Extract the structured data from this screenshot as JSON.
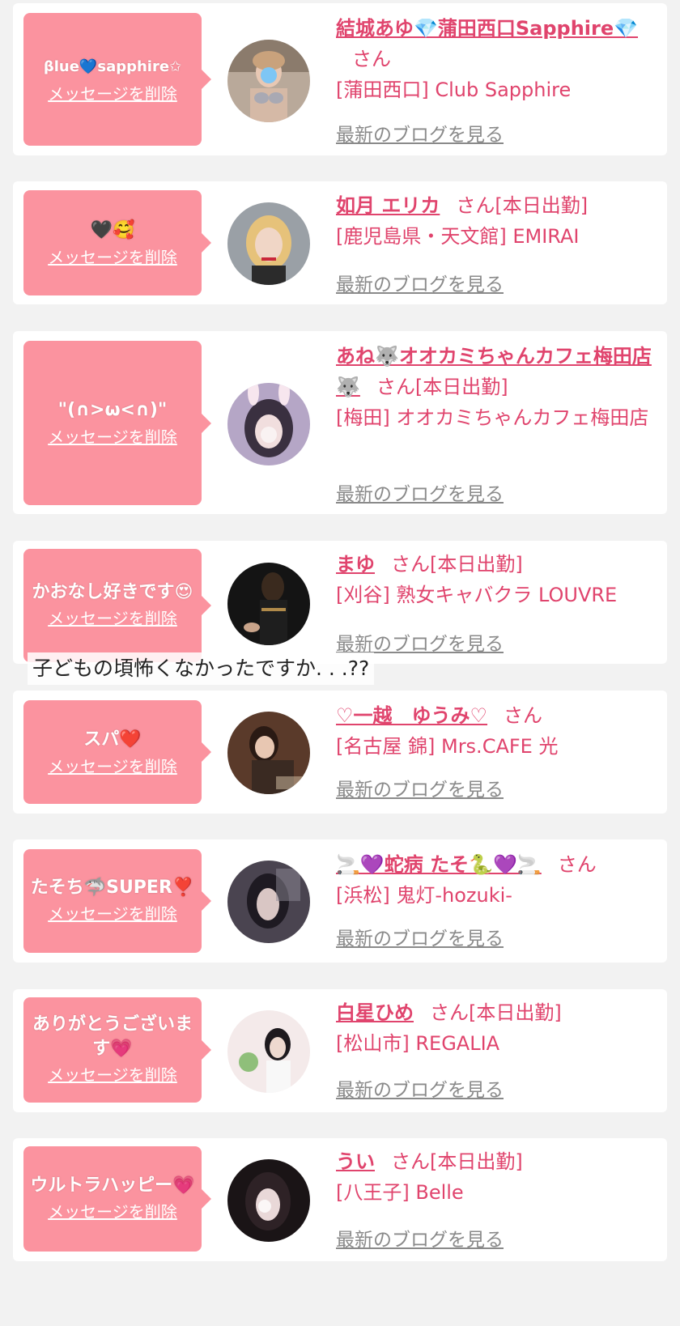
{
  "colors": {
    "background": "#f2f2f2",
    "card": "#ffffff",
    "bubble": "#fb939f",
    "name": "#e0446d",
    "blog_link": "#8a8a8a"
  },
  "delete_label": "メッセージを削除",
  "san_label": "さん",
  "blog_label": "最新のブログを見る",
  "caption": "子どもの頃怖くなかったですか. . .??",
  "items": [
    {
      "message": "βlue💙sapphire✩",
      "name": "結城あゆ💎蒲田西口Sapphire💎",
      "status": "",
      "shop": "[蒲田西口] Club Sapphire"
    },
    {
      "message": "🖤🥰",
      "name": "如月 エリカ",
      "status": "[本日出勤]",
      "shop": "[鹿児島県・天文館] EMIRAI"
    },
    {
      "message": "\"(∩>ω<∩)\"",
      "name": "あね🐺オオカミちゃんカフェ梅田店🐺",
      "status": "[本日出勤]",
      "shop": "[梅田] オオカミちゃんカフェ梅田店"
    },
    {
      "message": "かおなし好きです😍",
      "name": "まゆ",
      "status": "[本日出勤]",
      "shop": "[刈谷] 熟女キャバクラ LOUVRE"
    },
    {
      "message": "スパ❤️",
      "name": "♡一越　ゆうみ♡",
      "status": "",
      "shop": "[名古屋 錦] Mrs.CAFE 光"
    },
    {
      "message": "たそち🦈SUPER❣️",
      "name": "🚬💜蛇病 たそ🐍💜🚬",
      "status": "",
      "shop": "[浜松] 鬼灯-hozuki-"
    },
    {
      "message": "ありがとうございます💗",
      "name": "白星ひめ",
      "status": "[本日出勤]",
      "shop": "[松山市] REGALIA"
    },
    {
      "message": "ウルトラハッピー💗",
      "name": "うい",
      "status": "[本日出勤]",
      "shop": "[八王子] Belle"
    }
  ]
}
